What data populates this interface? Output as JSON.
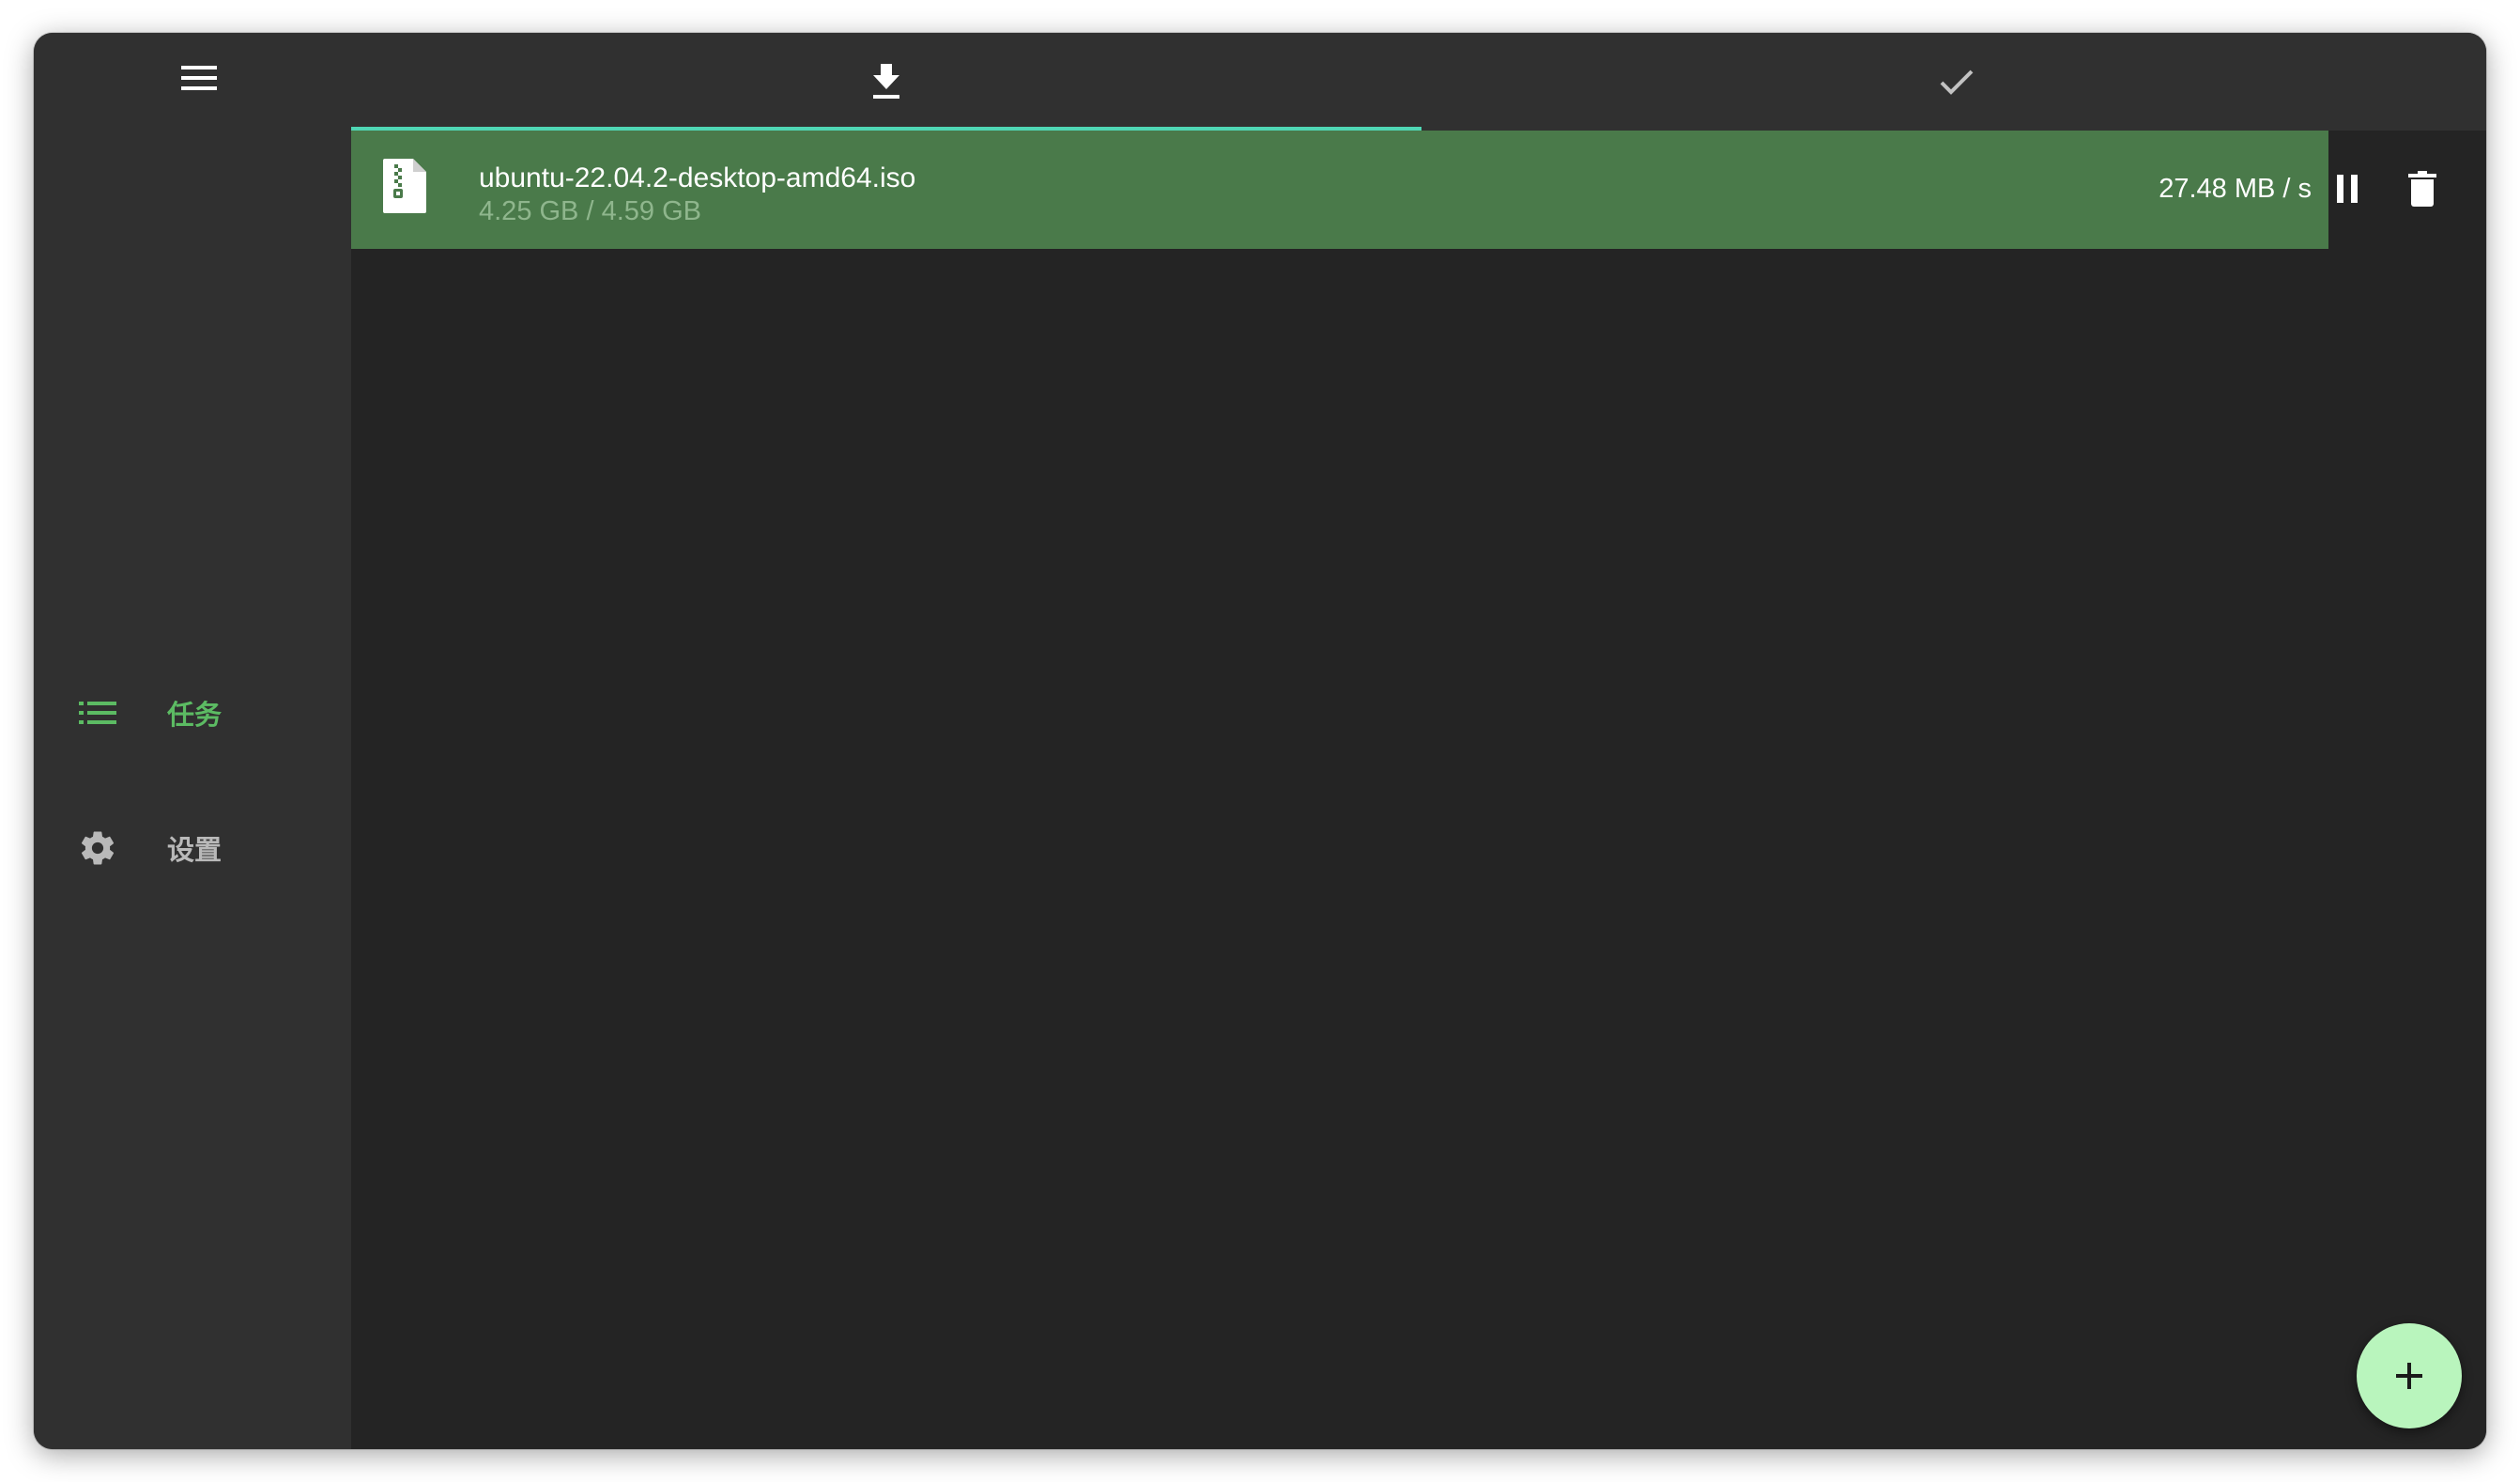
{
  "sidebar": {
    "menu_icon": "hamburger-menu-icon",
    "items": [
      {
        "label": "任务",
        "icon": "list-icon",
        "active": true
      },
      {
        "label": "设置",
        "icon": "gear-icon",
        "active": false
      }
    ]
  },
  "tabs": [
    {
      "icon": "download-icon",
      "active": true
    },
    {
      "icon": "check-icon",
      "active": false
    }
  ],
  "tasks": [
    {
      "file_icon": "zip-file-icon",
      "name": "ubuntu-22.04.2-desktop-amd64.iso",
      "size": "4.25 GB / 4.59 GB",
      "speed": "27.48 MB / s",
      "progress": 0.926
    }
  ],
  "fab": {
    "icon": "plus-icon"
  },
  "colors": {
    "accent": "#5cbb63",
    "tab_indicator": "#4fd6b4",
    "progress_fill": "#4a7a4a",
    "fab": "#b9f5bd",
    "sidebar_bg": "#303030",
    "content_bg": "#242424"
  }
}
